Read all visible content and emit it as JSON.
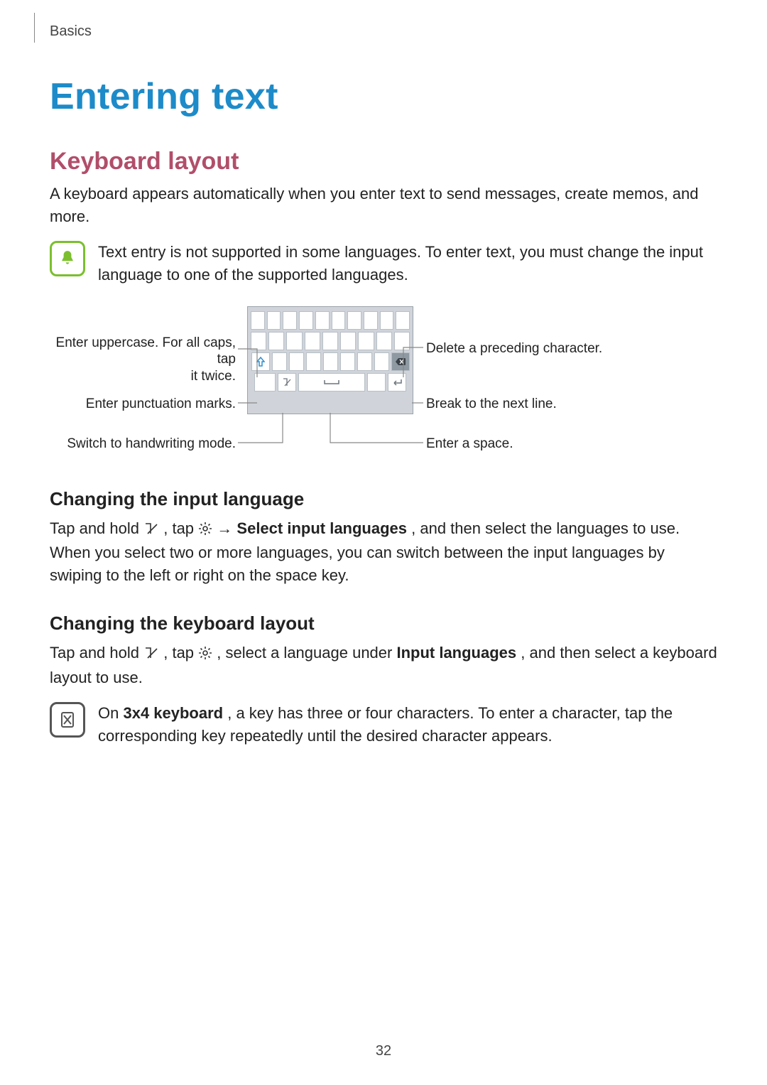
{
  "header": {
    "section": "Basics"
  },
  "title": "Entering text",
  "sub1": {
    "heading": "Keyboard layout",
    "para": "A keyboard appears automatically when you enter text to send messages, create memos, and more.",
    "note": "Text entry is not supported in some languages. To enter text, you must change the input language to one of the supported languages."
  },
  "diagram": {
    "left1a": "Enter uppercase. For all caps, tap",
    "left1b": "it twice.",
    "left2": "Enter punctuation marks.",
    "left3": "Switch to handwriting mode.",
    "right1": "Delete a preceding character.",
    "right2": "Break to the next line.",
    "right3": "Enter a space."
  },
  "sub2": {
    "heading": "Changing the input language",
    "p_lead": "Tap and hold ",
    "p_mid1": ", tap ",
    "p_arrow": " → ",
    "p_bold": "Select input languages",
    "p_tail": ", and then select the languages to use. When you select two or more languages, you can switch between the input languages by swiping to the left or right on the space key."
  },
  "sub3": {
    "heading": "Changing the keyboard layout",
    "p_lead": "Tap and hold ",
    "p_mid1": ", tap ",
    "p_mid2": ", select a language under ",
    "p_bold": "Input languages",
    "p_tail": ", and then select a keyboard layout to use.",
    "note_lead": "On ",
    "note_bold": "3x4 keyboard",
    "note_tail": ", a key has three or four characters. To enter a character, tap the corresponding key repeatedly until the desired character appears."
  },
  "page_number": "32"
}
